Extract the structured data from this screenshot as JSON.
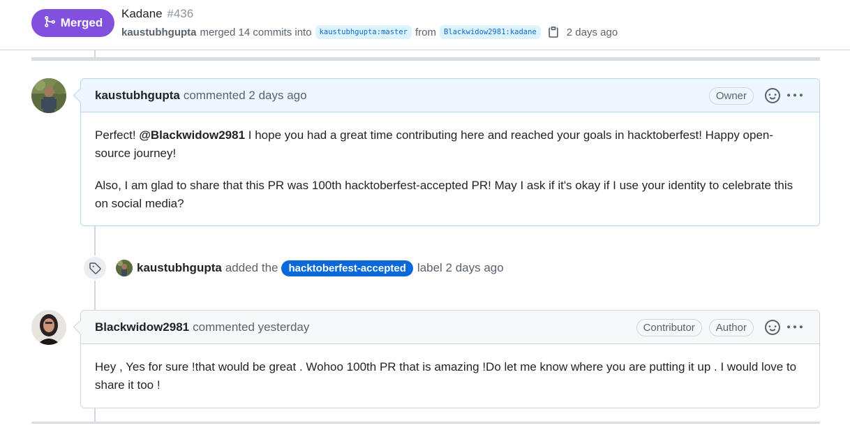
{
  "pr": {
    "state": "Merged",
    "title": "Kadane",
    "number": "#436",
    "merged_by": "kaustubhgupta",
    "merged_text": "merged 14 commits into",
    "base_branch": "kaustubhgupta:master",
    "from_text": "from",
    "head_branch": "Blackwidow2981:kadane",
    "time": "2 days ago"
  },
  "comments": [
    {
      "author": "kaustubhgupta",
      "action": "commented 2 days ago",
      "badges": [
        "Owner"
      ],
      "body": {
        "p1_lead": "Perfect!",
        "p1_mention": "@Blackwidow2981",
        "p1_rest": "I hope you had a great time contributing here and reached your goals in hacktoberfest! Happy open-source journey!",
        "p2": "Also, I am glad to share that this PR was 100th hacktoberfest-accepted PR! May I ask if it's okay if I use your identity to celebrate this on social media?"
      }
    },
    {
      "author": "Blackwidow2981",
      "action": "commented yesterday",
      "badges": [
        "Contributor",
        "Author"
      ],
      "body": {
        "p1": "Hey , Yes for sure !that would be great . Wohoo 100th PR that is amazing !Do let me know where you are putting it up . I would love to share it too !"
      }
    }
  ],
  "label_event": {
    "actor": "kaustubhgupta",
    "action": "added the",
    "label": "hacktoberfest-accepted",
    "label_color": "#0969da",
    "suffix": "label 2 days ago"
  },
  "icons": {
    "state": "git-merge-icon",
    "copy": "copy-icon",
    "event": "tag-icon",
    "reaction": "smiley-icon",
    "menu": "kebab-horizontal-icon"
  },
  "colors": {
    "merged": "#8250df",
    "link": "#0969da",
    "owner_header": "#eef6ff"
  }
}
